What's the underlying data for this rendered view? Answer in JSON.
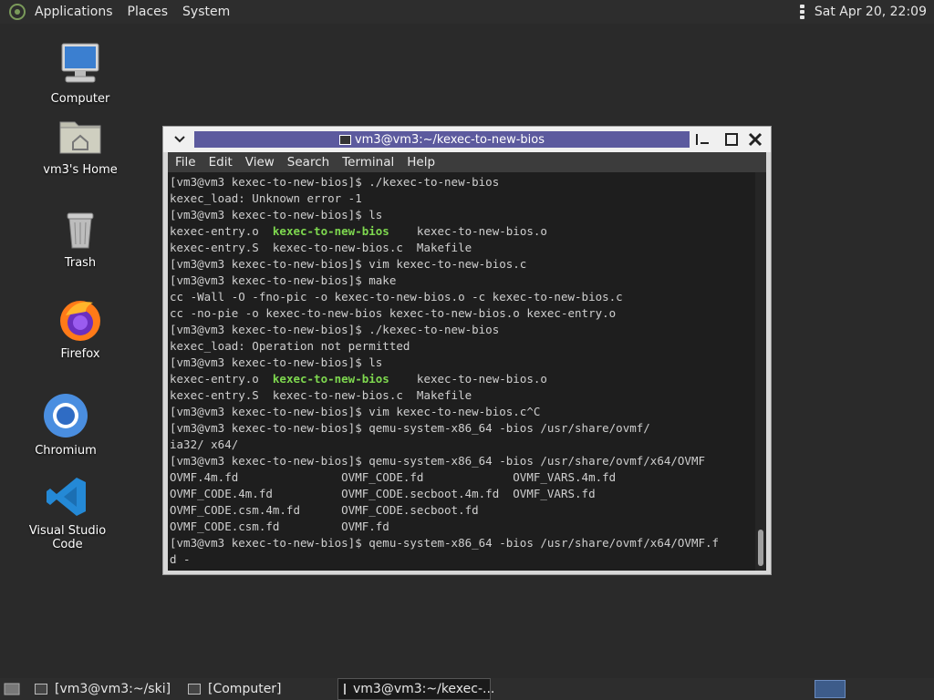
{
  "top_panel": {
    "menus": [
      "Applications",
      "Places",
      "System"
    ],
    "clock": "Sat Apr 20, 22:09"
  },
  "desktop_icons": [
    {
      "label": "Computer",
      "icon": "computer-icon"
    },
    {
      "label": "vm3's Home",
      "icon": "home-folder-icon"
    },
    {
      "label": "Trash",
      "icon": "trash-icon"
    },
    {
      "label": "Firefox",
      "icon": "firefox-icon"
    },
    {
      "label": "Chromium",
      "icon": "chromium-icon"
    },
    {
      "label": "Visual Studio Code",
      "icon": "vscode-icon"
    }
  ],
  "terminal": {
    "title": "vm3@vm3:~/kexec-to-new-bios",
    "menus": [
      "File",
      "Edit",
      "View",
      "Search",
      "Terminal",
      "Help"
    ],
    "lines": [
      "[vm3@vm3 kexec-to-new-bios]$ ./kexec-to-new-bios",
      "kexec_load: Unknown error -1",
      "[vm3@vm3 kexec-to-new-bios]$ ls",
      "kexec-entry.o  kexec-to-new-bios    kexec-to-new-bios.o",
      "kexec-entry.S  kexec-to-new-bios.c  Makefile",
      "[vm3@vm3 kexec-to-new-bios]$ vim kexec-to-new-bios.c",
      "[vm3@vm3 kexec-to-new-bios]$ make",
      "cc -Wall -O -fno-pic -o kexec-to-new-bios.o -c kexec-to-new-bios.c",
      "cc -no-pie -o kexec-to-new-bios kexec-to-new-bios.o kexec-entry.o",
      "[vm3@vm3 kexec-to-new-bios]$ ./kexec-to-new-bios",
      "kexec_load: Operation not permitted",
      "[vm3@vm3 kexec-to-new-bios]$ ls",
      "kexec-entry.o  kexec-to-new-bios    kexec-to-new-bios.o",
      "kexec-entry.S  kexec-to-new-bios.c  Makefile",
      "[vm3@vm3 kexec-to-new-bios]$ vim kexec-to-new-bios.c^C",
      "[vm3@vm3 kexec-to-new-bios]$ qemu-system-x86_64 -bios /usr/share/ovmf/",
      "ia32/ x64/",
      "[vm3@vm3 kexec-to-new-bios]$ qemu-system-x86_64 -bios /usr/share/ovmf/x64/OVMF",
      "OVMF.4m.fd               OVMF_CODE.fd             OVMF_VARS.4m.fd",
      "OVMF_CODE.4m.fd          OVMF_CODE.secboot.4m.fd  OVMF_VARS.fd",
      "OVMF_CODE.csm.4m.fd      OVMF_CODE.secboot.fd",
      "OVMF_CODE.csm.fd         OVMF.fd",
      "[vm3@vm3 kexec-to-new-bios]$ qemu-system-x86_64 -bios /usr/share/ovmf/x64/OVMF.f",
      "d -"
    ],
    "highlight": "kexec-to-new-bios",
    "highlight_lines": [
      3,
      12
    ],
    "colors": {
      "executable": "#7ed84f",
      "title_bg": "#5c5a9e"
    }
  },
  "taskbar": {
    "items": [
      {
        "label": "[vm3@vm3:~/ski]",
        "active": false
      },
      {
        "label": "[Computer]",
        "active": false
      },
      {
        "label": "vm3@vm3:~/kexec-...",
        "active": true
      }
    ]
  }
}
